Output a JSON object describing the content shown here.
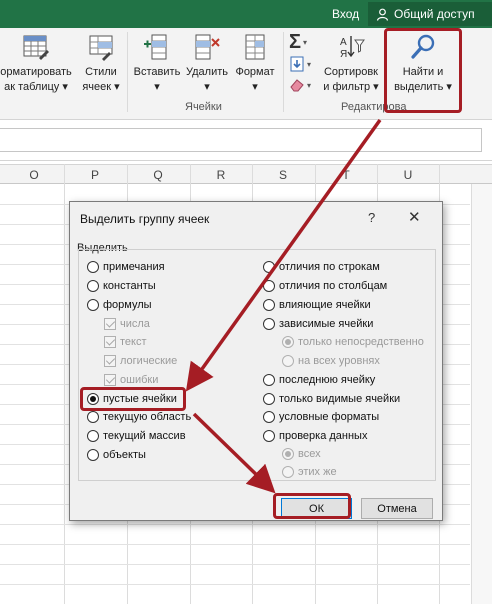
{
  "titlebar": {
    "signin": "Вход",
    "share": "Общий доступ",
    "color": "#217346"
  },
  "ribbon": {
    "buttons": [
      {
        "line1": "орматировать",
        "line2": "ак таблицу ▾",
        "icon": "format-as-table-icon"
      },
      {
        "line1": "Стили",
        "line2": "ячеек ▾",
        "icon": "cell-styles-icon"
      },
      {
        "line1": "Вставить",
        "line2": "▾",
        "icon": "insert-cells-icon"
      },
      {
        "line1": "Удалить",
        "line2": "▾",
        "icon": "delete-cells-icon"
      },
      {
        "line1": "Формат",
        "line2": "▾",
        "icon": "format-cells-icon"
      },
      {
        "line1": "Сортировк",
        "line2": "и фильтр ▾",
        "icon": "sort-filter-icon"
      },
      {
        "line1": "Найти и",
        "line2": "выделить ▾",
        "icon": "find-select-icon"
      }
    ],
    "group_cells": "Ячейки",
    "group_editing": "Редактирова"
  },
  "grid": {
    "columns": [
      "O",
      "P",
      "Q",
      "R",
      "S",
      "T",
      "U"
    ]
  },
  "dialog": {
    "title": "Выделить группу ячеек",
    "help": "?",
    "close": "✕",
    "section": "Выделить",
    "left_options": [
      {
        "label": "примечания",
        "type": "radio",
        "checked": false,
        "disabled": false
      },
      {
        "label": "константы",
        "type": "radio",
        "checked": false,
        "disabled": false
      },
      {
        "label": "формулы",
        "type": "radio",
        "checked": false,
        "disabled": false
      },
      {
        "label": "числа",
        "type": "checkbox",
        "checked": true,
        "disabled": true
      },
      {
        "label": "текст",
        "type": "checkbox",
        "checked": true,
        "disabled": true
      },
      {
        "label": "логические",
        "type": "checkbox",
        "checked": true,
        "disabled": true
      },
      {
        "label": "ошибки",
        "type": "checkbox",
        "checked": true,
        "disabled": true
      },
      {
        "label": "пустые ячейки",
        "type": "radio",
        "checked": true,
        "disabled": false
      },
      {
        "label": "текущую область",
        "type": "radio",
        "checked": false,
        "disabled": false
      },
      {
        "label": "текущий массив",
        "type": "radio",
        "checked": false,
        "disabled": false
      },
      {
        "label": "объекты",
        "type": "radio",
        "checked": false,
        "disabled": false
      }
    ],
    "right_options": [
      {
        "label": "отличия по строкам",
        "type": "radio",
        "checked": false,
        "disabled": false
      },
      {
        "label": "отличия по столбцам",
        "type": "radio",
        "checked": false,
        "disabled": false
      },
      {
        "label": "влияющие ячейки",
        "type": "radio",
        "checked": false,
        "disabled": false
      },
      {
        "label": "зависимые ячейки",
        "type": "radio",
        "checked": false,
        "disabled": false
      },
      {
        "label": "только непосредственно",
        "type": "radio",
        "checked": true,
        "disabled": true
      },
      {
        "label": "на всех уровнях",
        "type": "radio",
        "checked": false,
        "disabled": true
      },
      {
        "label": "последнюю ячейку",
        "type": "radio",
        "checked": false,
        "disabled": false
      },
      {
        "label": "только видимые ячейки",
        "type": "radio",
        "checked": false,
        "disabled": false
      },
      {
        "label": "условные форматы",
        "type": "radio",
        "checked": false,
        "disabled": false
      },
      {
        "label": "проверка данных",
        "type": "radio",
        "checked": false,
        "disabled": false
      },
      {
        "label": "всех",
        "type": "radio",
        "checked": true,
        "disabled": true
      },
      {
        "label": "этих же",
        "type": "radio",
        "checked": false,
        "disabled": true
      }
    ],
    "ok": "ОК",
    "cancel": "Отмена"
  },
  "annotation": {
    "color": "#a51d24"
  }
}
